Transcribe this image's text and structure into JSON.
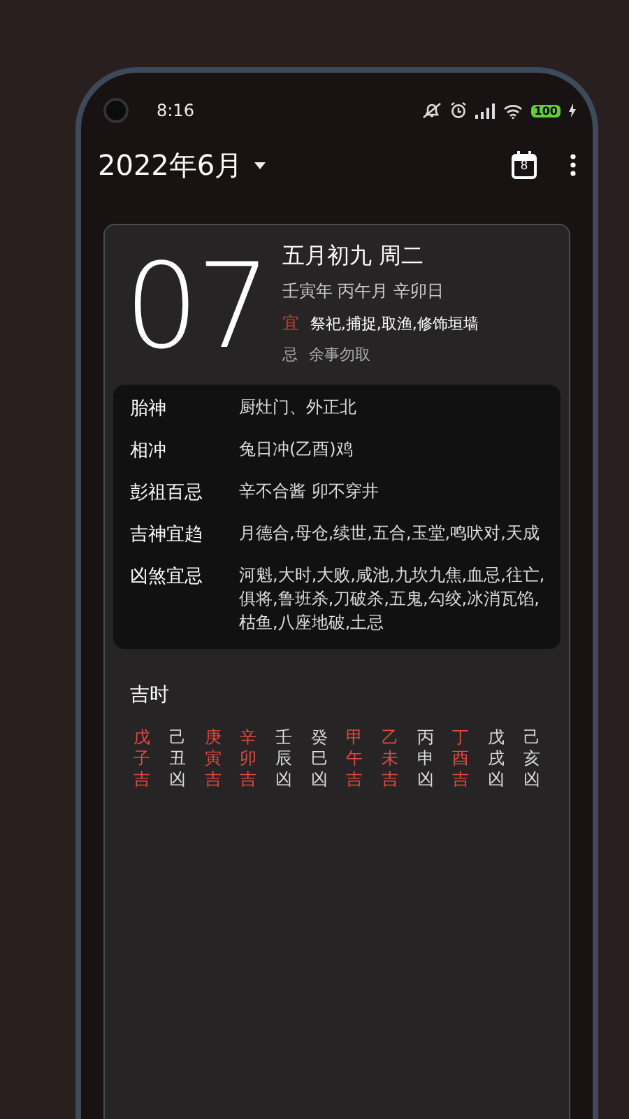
{
  "status_bar": {
    "time": "8:16",
    "battery": "100"
  },
  "header": {
    "title": "2022年6月",
    "calendar_day": "8"
  },
  "day": {
    "number": "07",
    "lunar": "五月初九 周二",
    "ganzhi": "壬寅年 丙午月 辛卯日",
    "yi_label": "宜",
    "yi": "祭祀,捕捉,取渔,修饰垣墙",
    "ji_label": "忌",
    "ji": "余事勿取"
  },
  "details": [
    {
      "label": "胎神",
      "value": "厨灶门、外正北"
    },
    {
      "label": "相冲",
      "value": "兔日冲(乙酉)鸡"
    },
    {
      "label": "彭祖百忌",
      "value": "辛不合酱 卯不穿井"
    },
    {
      "label": "吉神宜趋",
      "value": "月德合,母仓,续世,五合,玉堂,鸣吠对,天成"
    },
    {
      "label": "凶煞宜忌",
      "value": "河魁,大时,大败,咸池,九坎九焦,血忌,往亡,俱将,鲁班杀,刀破杀,五鬼,勾绞,冰消瓦馅,枯鱼,八座地破,土忌"
    }
  ],
  "hours_title": "吉时",
  "hours": [
    {
      "stem": "戊",
      "branch": "子",
      "luck": "吉",
      "lucky": true
    },
    {
      "stem": "己",
      "branch": "丑",
      "luck": "凶",
      "lucky": false
    },
    {
      "stem": "庚",
      "branch": "寅",
      "luck": "吉",
      "lucky": true
    },
    {
      "stem": "辛",
      "branch": "卯",
      "luck": "吉",
      "lucky": true
    },
    {
      "stem": "壬",
      "branch": "辰",
      "luck": "凶",
      "lucky": false
    },
    {
      "stem": "癸",
      "branch": "巳",
      "luck": "凶",
      "lucky": false
    },
    {
      "stem": "甲",
      "branch": "午",
      "luck": "吉",
      "lucky": true
    },
    {
      "stem": "乙",
      "branch": "未",
      "luck": "吉",
      "lucky": true
    },
    {
      "stem": "丙",
      "branch": "申",
      "luck": "凶",
      "lucky": false
    },
    {
      "stem": "丁",
      "branch": "酉",
      "luck": "吉",
      "lucky": true
    },
    {
      "stem": "戊",
      "branch": "戌",
      "luck": "凶",
      "lucky": false
    },
    {
      "stem": "己",
      "branch": "亥",
      "luck": "凶",
      "lucky": false
    }
  ]
}
